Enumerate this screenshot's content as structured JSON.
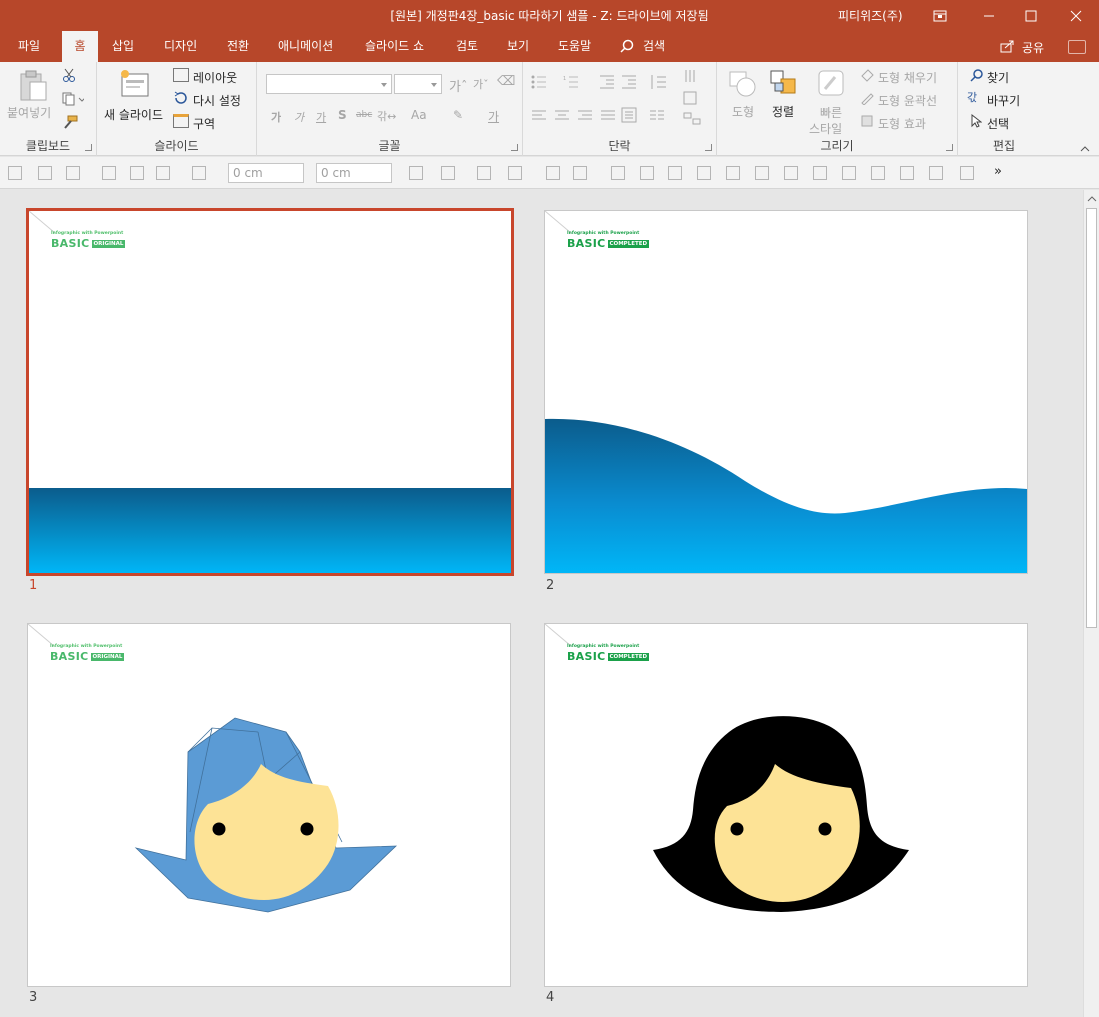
{
  "window": {
    "title": "[원본] 개정판4장_basic 따라하기 샘플 - Z: 드라이브에 저장됨",
    "user": "피티위즈(주)"
  },
  "tabs": [
    "파일",
    "홈",
    "삽입",
    "디자인",
    "전환",
    "애니메이션",
    "슬라이드 쇼",
    "검토",
    "보기",
    "도움말",
    "검색"
  ],
  "share_label": "공유",
  "ribbon": {
    "clipboard": {
      "paste": "붙여넣기",
      "label": "클립보드"
    },
    "slides": {
      "new_slide": "새 슬라이드",
      "layout": "레이아웃",
      "reset": "다시 설정",
      "section": "구역",
      "label": "슬라이드"
    },
    "font": {
      "label": "글꼴",
      "font_name": "",
      "font_size": ""
    },
    "paragraph": {
      "label": "단락"
    },
    "drawing": {
      "shapes": "도형",
      "arrange": "정렬",
      "quick_styles_1": "빠른",
      "quick_styles_2": "스타일",
      "fill": "도형 채우기",
      "outline": "도형 윤곽선",
      "effects": "도형 효과",
      "label": "그리기"
    },
    "editing": {
      "find": "찾기",
      "replace": "바꾸기",
      "select": "선택",
      "label": "편집"
    }
  },
  "toolbar2": {
    "width": "0 cm",
    "height": "0 cm"
  },
  "slides": [
    {
      "number": "1",
      "sub": "Infographic with Powerpoint",
      "brand": "BASIC",
      "tag": "ORIGINAL",
      "selected": true
    },
    {
      "number": "2",
      "sub": "Infographic with Powerpoint",
      "brand": "BASIC",
      "tag": "COMPLETED",
      "selected": false
    },
    {
      "number": "3",
      "sub": "Infographic with Powerpoint",
      "brand": "BASIC",
      "tag": "ORIGINAL",
      "selected": false
    },
    {
      "number": "4",
      "sub": "Infographic with Powerpoint",
      "brand": "BASIC",
      "tag": "COMPLETED",
      "selected": false
    }
  ],
  "colors": {
    "accent": "#b7472a",
    "selection": "#c8462c",
    "wave_top": "#0b5c8c",
    "wave_bottom": "#00b6f7",
    "face": "#fde396",
    "hair_draft": "#5b9bd5",
    "hair_final": "#000000",
    "badge_original": "#49b86b",
    "badge_completed": "#1ba14a"
  }
}
